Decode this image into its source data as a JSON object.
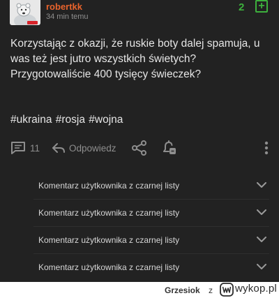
{
  "post": {
    "username": "robertkk",
    "timestamp": "34 min temu",
    "votes": "2",
    "plus_icon": "plus-square-icon",
    "body": "Korzystając z okazji, że ruskie boty dalej spamuja, u was też jest jutro wszystkich świetych? Przygotowaliście 400 tysięcy świeczek?",
    "tags": "#ukraina #rosja #wojna"
  },
  "actions": {
    "comments_count": "11",
    "reply_label": "Odpowiedz",
    "icons": [
      "comments-icon",
      "reply-icon",
      "share-icon",
      "notification-bell-icon",
      "more-options-icon"
    ]
  },
  "comments": [
    {
      "label": "Komentarz użytkownika z czarnej listy"
    },
    {
      "label": "Komentarz użytkownika z czarnej listy"
    },
    {
      "label": "Komentarz użytkownika z czarnej listy"
    },
    {
      "label": "Komentarz użytkownika z czarnej listy"
    }
  ],
  "footer": {
    "author": "Grzesiok",
    "separator": "z",
    "site": "wykop.pl"
  },
  "colors": {
    "background": "#1e1e1e",
    "username": "#e8632c",
    "vote_green": "#3db13d",
    "muted": "#8e8e8e"
  }
}
